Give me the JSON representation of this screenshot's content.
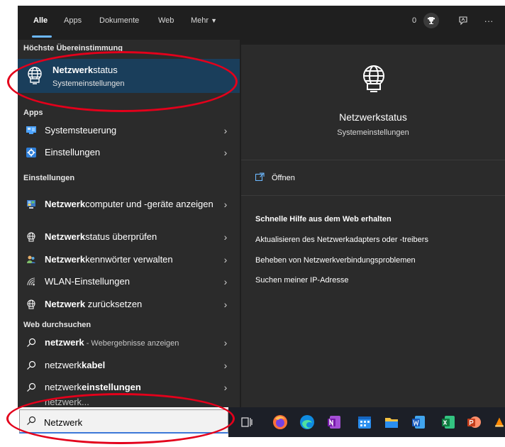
{
  "tabs": {
    "all": "Alle",
    "apps": "Apps",
    "docs": "Dokumente",
    "web": "Web",
    "more": "Mehr",
    "more_arrow": "▼"
  },
  "rewards_count": "0",
  "more_dots": "···",
  "best_match": {
    "section": "Höchste Übereinstimmung",
    "title_bold": "Netzwerk",
    "title_rest": "status",
    "subtitle": "Systemeinstellungen"
  },
  "apps": {
    "section": "Apps",
    "items": [
      {
        "label": "Systemsteuerung"
      },
      {
        "label": "Einstellungen"
      }
    ]
  },
  "settings": {
    "section": "Einstellungen",
    "items": [
      {
        "bold": "Netzwerk",
        "rest": "computer und -geräte anzeigen"
      },
      {
        "bold": "Netzwerk",
        "rest": "status überprüfen"
      },
      {
        "bold": "Netzwerk",
        "rest": "kennwörter verwalten"
      },
      {
        "bold": "",
        "rest": "WLAN-Einstellungen"
      },
      {
        "bold": "Netzwerk",
        "rest": " zurücksetzen"
      }
    ]
  },
  "web": {
    "section": "Web durchsuchen",
    "items": [
      {
        "bold": "netzwerk",
        "rest": " - Webergebnisse anzeigen"
      },
      {
        "bold": "kabel",
        "rest": "netzwerk"
      },
      {
        "bold": "einstellungen",
        "rest": "netzwerk"
      },
      {
        "bold": "",
        "rest": "netzwerk..."
      }
    ]
  },
  "chevron": "›",
  "detail": {
    "title": "Netzwerkstatus",
    "subtitle": "Systemeinstellungen",
    "open": "Öffnen",
    "help_title": "Schnelle Hilfe aus dem Web erhalten",
    "help_items": [
      "Aktualisieren des Netzwerkadapters oder -treibers",
      "Beheben von Netzwerkverbindungsproblemen",
      "Suchen meiner IP-Adresse"
    ]
  },
  "search": {
    "value": "Netzwerk"
  },
  "colors": {
    "accent": "#6cb8ff",
    "highlight": "#1a3e5b",
    "annotation": "#e3001b"
  }
}
